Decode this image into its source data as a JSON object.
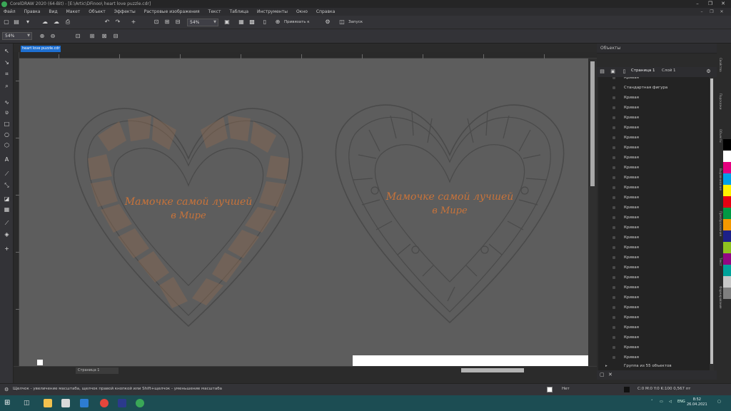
{
  "window": {
    "title": "CorelDRAW 2020 (64-Bit) - [E:\\Artic\\DFinoo\\ heart love puzzle.cdr]",
    "controls": [
      "–",
      "❐",
      "✕"
    ]
  },
  "menu": {
    "items": [
      "Файл",
      "Правка",
      "Вид",
      "Макет",
      "Объект",
      "Эффекты",
      "Растровые изображения",
      "Текст",
      "Таблица",
      "Инструменты",
      "Окно",
      "Справка"
    ]
  },
  "toolbar": {
    "zoom_value": "54%",
    "snap_label": "Привязать к",
    "launch_label": "Запуск"
  },
  "property_bar": {
    "zoom_combo": "54%"
  },
  "document": {
    "tab_label": "heart love puzzle.cdr",
    "page_tab": "Страница 1"
  },
  "artwork": {
    "left_text_line1": "Мамочке самой лучшей",
    "left_text_line2": "в Мире",
    "right_text_line1": "Мамочке самой лучшей",
    "right_text_line2": "в Мире"
  },
  "objects_panel": {
    "title": "Объекты",
    "page_label": "Страница 1",
    "layer_label": "Слой 1",
    "rows": [
      "Кривая",
      "Стандартная фигура",
      "Кривая",
      "Кривая",
      "Кривая",
      "Кривая",
      "Кривая",
      "Кривая",
      "Кривая",
      "Кривая",
      "Кривая",
      "Кривая",
      "Кривая",
      "Кривая",
      "Кривая",
      "Кривая",
      "Кривая",
      "Кривая",
      "Кривая",
      "Кривая",
      "Кривая",
      "Кривая",
      "Кривая",
      "Кривая",
      "Кривая",
      "Кривая",
      "Кривая",
      "Кривая",
      "Кривая"
    ],
    "group_label": "Группа из 55 объектов"
  },
  "status": {
    "hint": "Щелчок - увеличение масштаба, щелчок правой кнопкой или Shift+щелчок - уменьшение масштаба",
    "fill_label": "Нет",
    "outline_label": "C:0 M:0 Y:0 K:100  0,567 пт"
  },
  "taskbar": {
    "time": "8:52",
    "date": "26.04.2021"
  },
  "colors": {
    "canvas": "#5d5d5d",
    "accent_orange": "#c8733a",
    "selection_blue": "#1e6fd0",
    "taskbar": "#1c4d53"
  },
  "palette": [
    "#000000",
    "#ffffff",
    "#e4007f",
    "#00a0e9",
    "#fff100",
    "#e60012",
    "#009944",
    "#f39800",
    "#1d2088",
    "#8fc31f",
    "#920783",
    "#00a29a",
    "#c8c8c8",
    "#7f7f7f"
  ]
}
